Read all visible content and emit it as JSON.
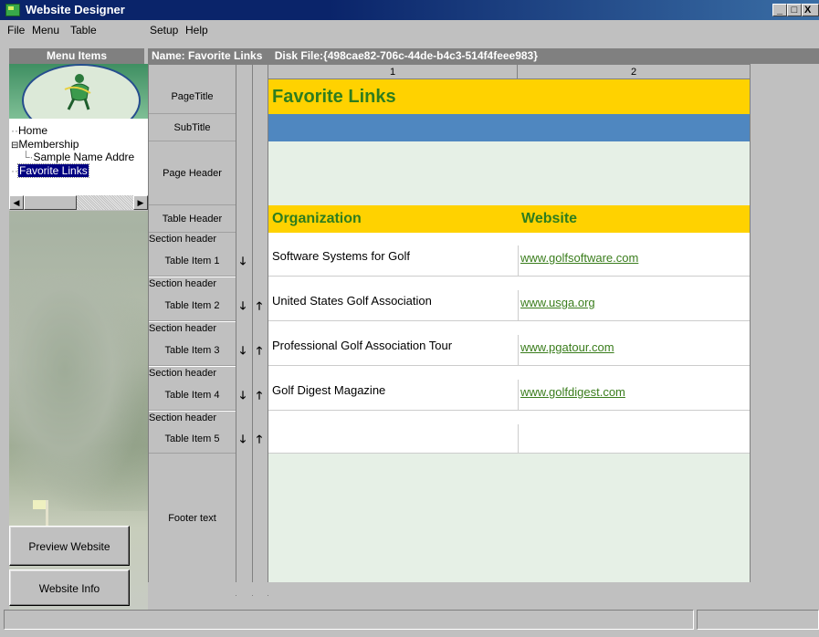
{
  "window": {
    "title": "Website Designer",
    "minimize": "_",
    "maximize": "□",
    "close": "X"
  },
  "menu": [
    "File",
    "Menu",
    "Table",
    "Setup",
    "Help"
  ],
  "header": {
    "left": "Menu Items",
    "right": "Name: Favorite Links    Disk File:{498cae82-706c-44de-b4c3-514f4feee983}"
  },
  "tree": {
    "items": [
      "Home",
      "Membership",
      "Sample Name Addre",
      "Favorite Links"
    ],
    "expander": "⊟"
  },
  "buttons": {
    "preview": "Preview Website",
    "info": "Website Info"
  },
  "grid": {
    "col_headers": [
      "1",
      "2"
    ],
    "row_labels": {
      "page_title": "PageTitle",
      "sub_title": "SubTitle",
      "page_header": "Page Header",
      "table_header": "Table Header",
      "section_header": "Section header",
      "footer": "Footer text"
    },
    "page_title_text": "Favorite Links",
    "table_header": [
      "Organization",
      "Website"
    ],
    "items": [
      {
        "label": "Table Item 1",
        "org": "Software Systems for Golf",
        "site": "www.golfsoftware.com"
      },
      {
        "label": "Table Item 2",
        "org": "United States Golf Association",
        "site": "www.usga.org"
      },
      {
        "label": "Table Item 3",
        "org": "Professional Golf Association Tour",
        "site": "www.pgatour.com"
      },
      {
        "label": "Table Item 4",
        "org": "Golf Digest Magazine",
        "site": "www.golfdigest.com"
      },
      {
        "label": "Table Item 5",
        "org": "",
        "site": ""
      }
    ],
    "arrow_down": "🡓",
    "arrow_up": "🡑"
  },
  "colors": {
    "title_band": "#ffd200",
    "title_text": "#2e7d1e",
    "subtitle_band": "#4f87c0",
    "header_band": "#ffd200",
    "pale_green": "#e6f0e6",
    "selection": "#000080"
  }
}
